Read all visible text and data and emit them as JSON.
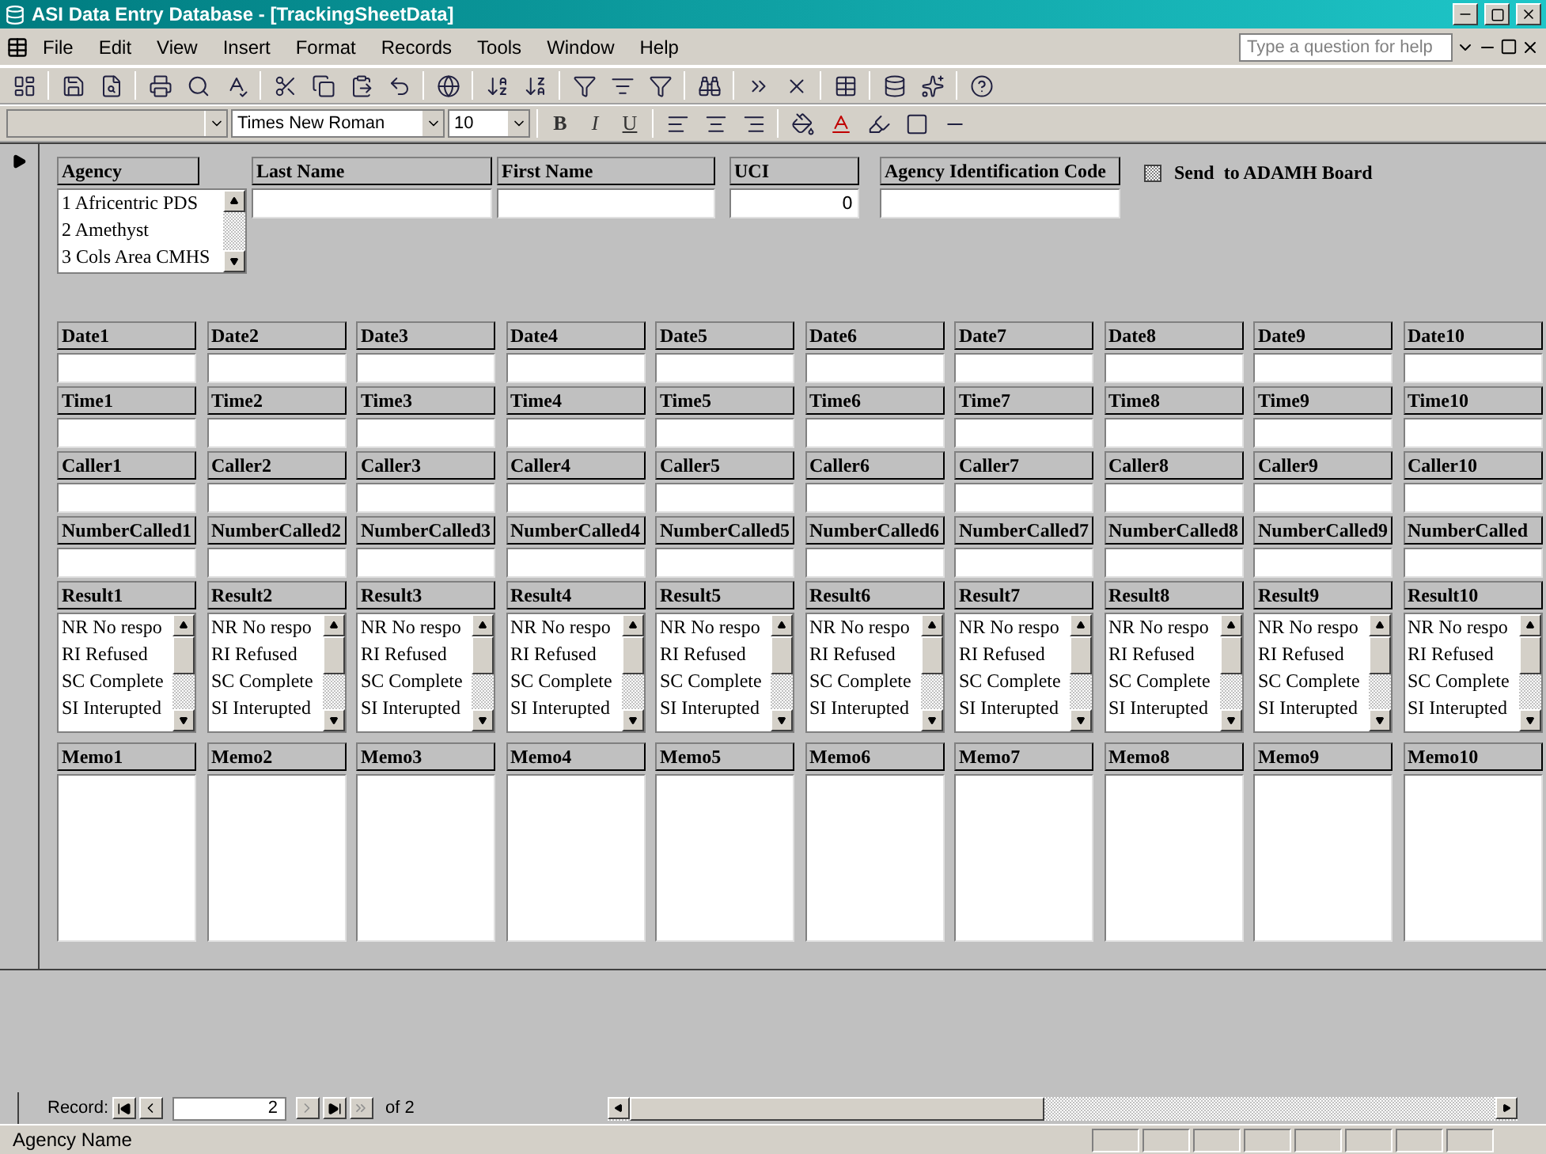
{
  "window": {
    "title": "ASI Data Entry Database - [TrackingSheetData]"
  },
  "menu": [
    "File",
    "Edit",
    "View",
    "Insert",
    "Format",
    "Records",
    "Tools",
    "Window",
    "Help"
  ],
  "help_box": {
    "placeholder": "Type a question for help"
  },
  "format_toolbar": {
    "font": "Times New Roman",
    "size": "10",
    "style_buttons": [
      "B",
      "I",
      "U"
    ]
  },
  "form": {
    "header_fields": [
      {
        "kind": "list",
        "label": "Agency",
        "items": [
          "1 Africentric PDS",
          "2 Amethyst",
          "3 Cols Area CMHS"
        ]
      },
      {
        "kind": "text",
        "label": "Last Name"
      },
      {
        "kind": "text",
        "label": "First Name"
      },
      {
        "kind": "number",
        "label": "UCI",
        "value": "0"
      },
      {
        "kind": "text",
        "label": "Agency Identification Code"
      }
    ],
    "checkbox": {
      "label": "Send  to ADAMH Board",
      "indeterminate": true
    },
    "columns": [
      {
        "fields": [
          {
            "kind": "text",
            "label": "Date1"
          },
          {
            "kind": "text",
            "label": "Time1"
          },
          {
            "kind": "text",
            "label": "Caller1"
          },
          {
            "kind": "text",
            "label": "NumberCalled1"
          },
          {
            "kind": "list",
            "label": "Result1",
            "options": [
              "NR No respo",
              "RI Refused",
              "SC Complete",
              "SI Interupted"
            ]
          },
          {
            "kind": "memo",
            "label": "Memo1"
          }
        ]
      },
      {
        "fields": [
          {
            "kind": "text",
            "label": "Date2"
          },
          {
            "kind": "text",
            "label": "Time2"
          },
          {
            "kind": "text",
            "label": "Caller2"
          },
          {
            "kind": "text",
            "label": "NumberCalled2"
          },
          {
            "kind": "list",
            "label": "Result2",
            "options": [
              "NR No respo",
              "RI Refused",
              "SC Complete",
              "SI Interupted"
            ]
          },
          {
            "kind": "memo",
            "label": "Memo2"
          }
        ]
      },
      {
        "fields": [
          {
            "kind": "text",
            "label": "Date3"
          },
          {
            "kind": "text",
            "label": "Time3"
          },
          {
            "kind": "text",
            "label": "Caller3"
          },
          {
            "kind": "text",
            "label": "NumberCalled3"
          },
          {
            "kind": "list",
            "label": "Result3",
            "options": [
              "NR No respo",
              "RI Refused",
              "SC Complete",
              "SI Interupted"
            ]
          },
          {
            "kind": "memo",
            "label": "Memo3"
          }
        ]
      },
      {
        "fields": [
          {
            "kind": "text",
            "label": "Date4"
          },
          {
            "kind": "text",
            "label": "Time4"
          },
          {
            "kind": "text",
            "label": "Caller4"
          },
          {
            "kind": "text",
            "label": "NumberCalled4"
          },
          {
            "kind": "list",
            "label": "Result4",
            "options": [
              "NR No respo",
              "RI Refused",
              "SC Complete",
              "SI Interupted"
            ]
          },
          {
            "kind": "memo",
            "label": "Memo4"
          }
        ]
      },
      {
        "fields": [
          {
            "kind": "text",
            "label": "Date5"
          },
          {
            "kind": "text",
            "label": "Time5"
          },
          {
            "kind": "text",
            "label": "Caller5"
          },
          {
            "kind": "text",
            "label": "NumberCalled5"
          },
          {
            "kind": "list",
            "label": "Result5",
            "options": [
              "NR No respo",
              "RI Refused",
              "SC Complete",
              "SI Interupted"
            ]
          },
          {
            "kind": "memo",
            "label": "Memo5"
          }
        ]
      },
      {
        "fields": [
          {
            "kind": "text",
            "label": "Date6"
          },
          {
            "kind": "text",
            "label": "Time6"
          },
          {
            "kind": "text",
            "label": "Caller6"
          },
          {
            "kind": "text",
            "label": "NumberCalled6"
          },
          {
            "kind": "list",
            "label": "Result6",
            "options": [
              "NR No respo",
              "RI Refused",
              "SC Complete",
              "SI Interupted"
            ]
          },
          {
            "kind": "memo",
            "label": "Memo6"
          }
        ]
      },
      {
        "fields": [
          {
            "kind": "text",
            "label": "Date7"
          },
          {
            "kind": "text",
            "label": "Time7"
          },
          {
            "kind": "text",
            "label": "Caller7"
          },
          {
            "kind": "text",
            "label": "NumberCalled7"
          },
          {
            "kind": "list",
            "label": "Result7",
            "options": [
              "NR No respo",
              "RI Refused",
              "SC Complete",
              "SI Interupted"
            ]
          },
          {
            "kind": "memo",
            "label": "Memo7"
          }
        ]
      },
      {
        "fields": [
          {
            "kind": "text",
            "label": "Date8"
          },
          {
            "kind": "text",
            "label": "Time8"
          },
          {
            "kind": "text",
            "label": "Caller8"
          },
          {
            "kind": "text",
            "label": "NumberCalled8"
          },
          {
            "kind": "list",
            "label": "Result8",
            "options": [
              "NR No respo",
              "RI Refused",
              "SC Complete",
              "SI Interupted"
            ]
          },
          {
            "kind": "memo",
            "label": "Memo8"
          }
        ]
      },
      {
        "fields": [
          {
            "kind": "text",
            "label": "Date9"
          },
          {
            "kind": "text",
            "label": "Time9"
          },
          {
            "kind": "text",
            "label": "Caller9"
          },
          {
            "kind": "text",
            "label": "NumberCalled9"
          },
          {
            "kind": "list",
            "label": "Result9",
            "options": [
              "NR No respo",
              "RI Refused",
              "SC Complete",
              "SI Interupted"
            ]
          },
          {
            "kind": "memo",
            "label": "Memo9"
          }
        ]
      },
      {
        "fields": [
          {
            "kind": "text",
            "label": "Date10"
          },
          {
            "kind": "text",
            "label": "Time10"
          },
          {
            "kind": "text",
            "label": "Caller10"
          },
          {
            "kind": "text",
            "label": "NumberCalled"
          },
          {
            "kind": "list",
            "label": "Result10",
            "options": [
              "NR No respo",
              "RI Refused",
              "SC Complete",
              "SI Interupted"
            ]
          },
          {
            "kind": "memo",
            "label": "Memo10"
          }
        ]
      }
    ]
  },
  "record_bar": {
    "label": "Record:",
    "current": "2",
    "total": "of 2"
  },
  "status_bar": {
    "text": "Agency Name"
  }
}
